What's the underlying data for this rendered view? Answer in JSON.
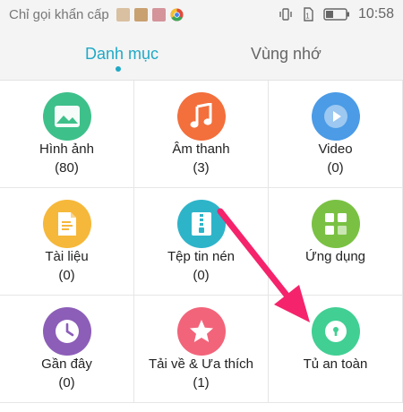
{
  "status_bar": {
    "carrier": "Chỉ gọi khẩn cấp",
    "time": "10:58"
  },
  "tabs": [
    {
      "label": "Danh mục",
      "active": true
    },
    {
      "label": "Vùng nhớ",
      "active": false
    }
  ],
  "categories": [
    {
      "name": "Hình ảnh",
      "count": "(80)",
      "icon": "image-icon",
      "color": "#3ec08a"
    },
    {
      "name": "Âm thanh",
      "count": "(3)",
      "icon": "music-icon",
      "color": "#f36f3c"
    },
    {
      "name": "Video",
      "count": "(0)",
      "icon": "play-icon",
      "color": "#4b9be6"
    },
    {
      "name": "Tài liệu",
      "count": "(0)",
      "icon": "document-icon",
      "color": "#f6b83a"
    },
    {
      "name": "Tệp tin nén",
      "count": "(0)",
      "icon": "zip-icon",
      "color": "#2eb4c9"
    },
    {
      "name": "Ứng dụng",
      "count": "",
      "icon": "apps-icon",
      "color": "#7ac143"
    },
    {
      "name": "Gần đây",
      "count": "(0)",
      "icon": "clock-icon",
      "color": "#8c5eb8"
    },
    {
      "name": "Tải về & Ưa thích",
      "count": "(1)",
      "icon": "star-icon",
      "color": "#f2647a"
    },
    {
      "name": "Tủ an toàn",
      "count": "",
      "icon": "lock-icon",
      "color": "#41cf93"
    }
  ],
  "colors": {
    "accent": "#1fa9c6",
    "arrow": "#f5236b"
  }
}
